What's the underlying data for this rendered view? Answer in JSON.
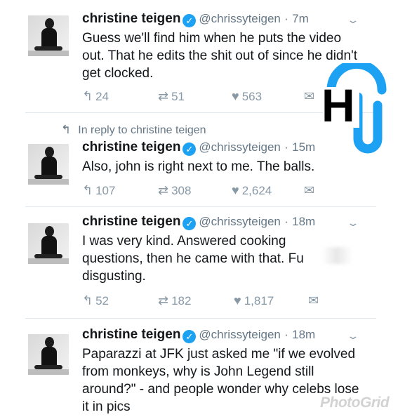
{
  "tweets": [
    {
      "name": "christine teigen",
      "handle": "@chrissyteigen",
      "dot": "·",
      "time": "7m",
      "text": "Guess we'll find him when he puts the video out. That he edits the shit out of since he didn't get clocked.",
      "replies": "24",
      "retweets": "51",
      "likes": "563"
    },
    {
      "reply_to": "In reply to christine teigen",
      "name": "christine teigen",
      "handle": "@chrissyteigen",
      "dot": "·",
      "time": "15m",
      "text": "Also, john is right next to me. The balls.",
      "replies": "107",
      "retweets": "308",
      "likes": "2,624"
    },
    {
      "name": "christine teigen",
      "handle": "@chrissyteigen",
      "dot": "·",
      "time": "18m",
      "text_lines": [
        "I was very kind. Answered cooking",
        "questions, then he came with that. Fu",
        "disgusting."
      ],
      "replies": "52",
      "retweets": "182",
      "likes": "1,817"
    },
    {
      "name": "christine teigen",
      "handle": "@chrissyteigen",
      "dot": "·",
      "time": "18m",
      "text": "Paparazzi at JFK just asked me \"if we evolved from monkeys, why is John Legend still around?\" - and people wonder why celebs lose it in pics"
    }
  ],
  "icons": {
    "reply": "reply-icon",
    "retweet": "retweet-icon",
    "like": "heart-icon",
    "dm": "envelope-icon",
    "verified": "verified-badge-icon",
    "chevron": "chevron-down-icon"
  },
  "glyphs": {
    "reply": "↰",
    "retweet": "⇄",
    "like": "♥",
    "dm": "✉",
    "verified": "✓",
    "chevron": "⌄",
    "reply_to": "↰"
  },
  "logo": {
    "letter": "H",
    "ring_color": "#1da1f2",
    "letter_color": "#000000"
  },
  "watermark": "PhotoGrid",
  "colors": {
    "accent": "#1da1f2",
    "muted": "#8899a6",
    "text": "#14171a"
  }
}
